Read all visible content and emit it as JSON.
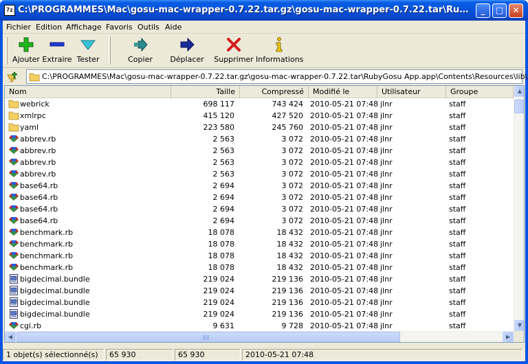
{
  "window": {
    "title": "C:\\PROGRAMMES\\Mac\\gosu-mac-wrapper-0.7.22.tar.gz\\gosu-mac-wrapper-0.7.22.tar\\RubyGosu App.app\\Contents\\Resources\\lib\\",
    "app_icon_text": "7z",
    "minimize_glyph": "_",
    "maximize_glyph": "□",
    "close_glyph": "✕"
  },
  "menu": [
    "Fichier",
    "Edition",
    "Affichage",
    "Favoris",
    "Outils",
    "Aide"
  ],
  "toolbar": {
    "add": "Ajouter",
    "extract": "Extraire",
    "test": "Tester",
    "copy": "Copier",
    "move": "Déplacer",
    "delete": "Supprimer",
    "info": "Informations"
  },
  "address": {
    "path": "C:\\PROGRAMMES\\Mac\\gosu-mac-wrapper-0.7.22.tar.gz\\gosu-mac-wrapper-0.7.22.tar\\RubyGosu App.app\\Contents\\Resources\\lib\\"
  },
  "columns": {
    "name": "Nom",
    "size": "Taille",
    "compressed": "Compressé",
    "modified": "Modifié le",
    "user": "Utilisateur",
    "group": "Groupe"
  },
  "files": [
    {
      "type": "folder",
      "name": "webrick",
      "size": "698 117",
      "compressed": "743 424",
      "modified": "2010-05-21 07:48",
      "user": "jlnr",
      "group": "staff"
    },
    {
      "type": "folder",
      "name": "xmlrpc",
      "size": "415 120",
      "compressed": "427 520",
      "modified": "2010-05-21 07:48",
      "user": "jlnr",
      "group": "staff"
    },
    {
      "type": "folder",
      "name": "yaml",
      "size": "223 580",
      "compressed": "245 760",
      "modified": "2010-05-21 07:48",
      "user": "jlnr",
      "group": "staff"
    },
    {
      "type": "ruby",
      "name": "abbrev.rb",
      "size": "2 563",
      "compressed": "3 072",
      "modified": "2010-05-21 07:48",
      "user": "jlnr",
      "group": "staff"
    },
    {
      "type": "ruby",
      "name": "abbrev.rb",
      "size": "2 563",
      "compressed": "3 072",
      "modified": "2010-05-21 07:48",
      "user": "jlnr",
      "group": "staff"
    },
    {
      "type": "ruby",
      "name": "abbrev.rb",
      "size": "2 563",
      "compressed": "3 072",
      "modified": "2010-05-21 07:48",
      "user": "jlnr",
      "group": "staff"
    },
    {
      "type": "ruby",
      "name": "abbrev.rb",
      "size": "2 563",
      "compressed": "3 072",
      "modified": "2010-05-21 07:48",
      "user": "jlnr",
      "group": "staff"
    },
    {
      "type": "ruby",
      "name": "base64.rb",
      "size": "2 694",
      "compressed": "3 072",
      "modified": "2010-05-21 07:48",
      "user": "jlnr",
      "group": "staff"
    },
    {
      "type": "ruby",
      "name": "base64.rb",
      "size": "2 694",
      "compressed": "3 072",
      "modified": "2010-05-21 07:48",
      "user": "jlnr",
      "group": "staff"
    },
    {
      "type": "ruby",
      "name": "base64.rb",
      "size": "2 694",
      "compressed": "3 072",
      "modified": "2010-05-21 07:48",
      "user": "jlnr",
      "group": "staff"
    },
    {
      "type": "ruby",
      "name": "base64.rb",
      "size": "2 694",
      "compressed": "3 072",
      "modified": "2010-05-21 07:48",
      "user": "jlnr",
      "group": "staff"
    },
    {
      "type": "ruby",
      "name": "benchmark.rb",
      "size": "18 078",
      "compressed": "18 432",
      "modified": "2010-05-21 07:48",
      "user": "jlnr",
      "group": "staff"
    },
    {
      "type": "ruby",
      "name": "benchmark.rb",
      "size": "18 078",
      "compressed": "18 432",
      "modified": "2010-05-21 07:48",
      "user": "jlnr",
      "group": "staff"
    },
    {
      "type": "ruby",
      "name": "benchmark.rb",
      "size": "18 078",
      "compressed": "18 432",
      "modified": "2010-05-21 07:48",
      "user": "jlnr",
      "group": "staff"
    },
    {
      "type": "ruby",
      "name": "benchmark.rb",
      "size": "18 078",
      "compressed": "18 432",
      "modified": "2010-05-21 07:48",
      "user": "jlnr",
      "group": "staff"
    },
    {
      "type": "bundle",
      "name": "bigdecimal.bundle",
      "size": "219 024",
      "compressed": "219 136",
      "modified": "2010-05-21 07:48",
      "user": "jlnr",
      "group": "staff"
    },
    {
      "type": "bundle",
      "name": "bigdecimal.bundle",
      "size": "219 024",
      "compressed": "219 136",
      "modified": "2010-05-21 07:48",
      "user": "jlnr",
      "group": "staff"
    },
    {
      "type": "bundle",
      "name": "bigdecimal.bundle",
      "size": "219 024",
      "compressed": "219 136",
      "modified": "2010-05-21 07:48",
      "user": "jlnr",
      "group": "staff"
    },
    {
      "type": "bundle",
      "name": "bigdecimal.bundle",
      "size": "219 024",
      "compressed": "219 136",
      "modified": "2010-05-21 07:48",
      "user": "jlnr",
      "group": "staff"
    },
    {
      "type": "ruby",
      "name": "cgi.rb",
      "size": "9 631",
      "compressed": "9 728",
      "modified": "2010-05-21 07:48",
      "user": "jlnr",
      "group": "staff"
    }
  ],
  "status": {
    "selection": "1 objet(s) sélectionné(s)",
    "size": "65 930",
    "compressed": "65 930",
    "date": "2010-05-21 07:48"
  },
  "icons": {
    "folder": "folder-icon",
    "ruby": "ruby-file-icon",
    "bundle": "bundle-file-icon"
  },
  "colors": {
    "titlebar": "#0653da",
    "folder": "#f3d064",
    "selection": "#316ac5"
  }
}
